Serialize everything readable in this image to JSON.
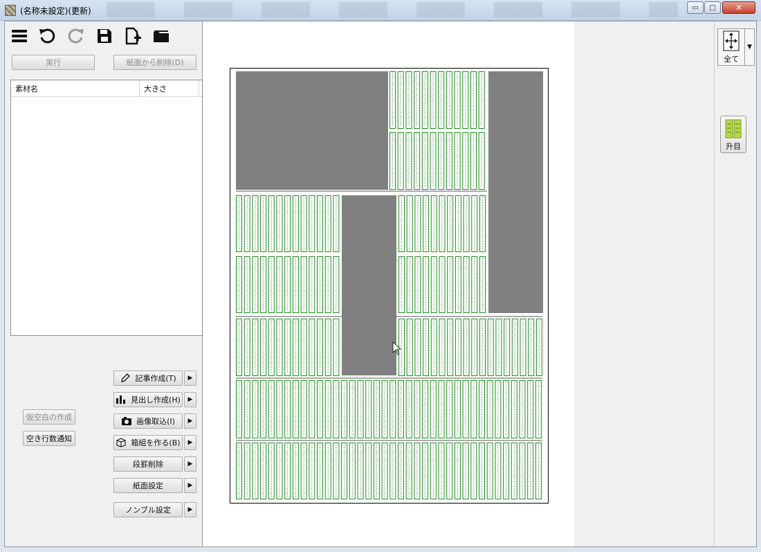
{
  "window": {
    "title": "(名称未設定)(更新)",
    "minimize_glyph": "▭",
    "maximize_glyph": "□",
    "close_glyph": "✕"
  },
  "toolbar": {
    "icons": [
      "menu-icon",
      "undo-icon",
      "redo-icon",
      "save-icon",
      "new-page-icon",
      "open-folder-icon"
    ]
  },
  "actions": {
    "execute_label": "実行",
    "remove_from_page_label": "紙面から削除(D)"
  },
  "material_table": {
    "columns": [
      "素材名",
      "大きさ"
    ],
    "rows": []
  },
  "left_buttons": {
    "temp_blank_label": "仮空白の作成",
    "empty_lines_label": "空き行数通知"
  },
  "menu_buttons": [
    {
      "label": "記事作成(T)",
      "icon": "pencil-icon"
    },
    {
      "label": "見出し作成(H)",
      "icon": "headline-icon"
    },
    {
      "label": "画像取込(I)",
      "icon": "camera-icon"
    },
    {
      "label": "箱組を作る(B)",
      "icon": "box-icon"
    },
    {
      "label": "段罫削除",
      "icon": ""
    },
    {
      "label": "紙面設定",
      "icon": ""
    },
    {
      "label": "ノンブル設定",
      "icon": ""
    }
  ],
  "dropdown_glyph": "▶",
  "right_toolbar": {
    "fit_all_label": "全て",
    "grid_label": "升目",
    "dropdown_glyph": "▼"
  },
  "colors": {
    "grid_stroke": "#1f8a1f",
    "image_fill": "#808080",
    "grid_icon_fill": "#b5d84a"
  }
}
